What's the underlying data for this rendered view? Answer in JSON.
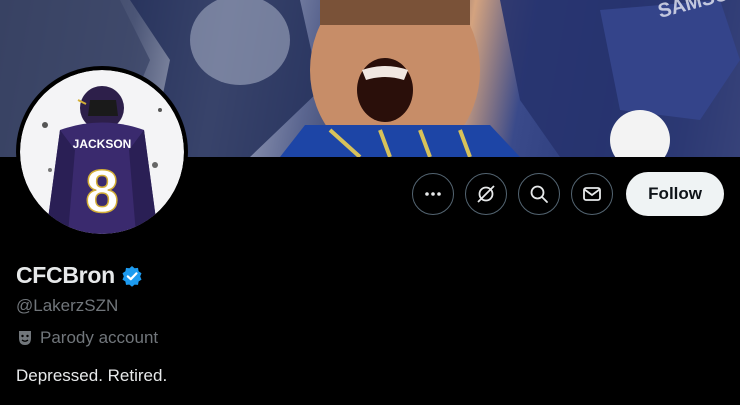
{
  "profile": {
    "display_name": "CFCBron",
    "handle": "@LakerzSZN",
    "label": "Parody account",
    "bio": "Depressed. Retired.",
    "verified": true
  },
  "avatar": {
    "jersey_name": "JACKSON",
    "jersey_number": "8"
  },
  "actions": {
    "follow_label": "Follow",
    "icons": [
      "more-icon",
      "grok-icon",
      "search-icon",
      "message-icon"
    ]
  },
  "colors": {
    "background": "#000000",
    "verified_badge": "#1d9bf0",
    "follow_bg": "#eff3f4",
    "secondary_text": "#71767b"
  }
}
